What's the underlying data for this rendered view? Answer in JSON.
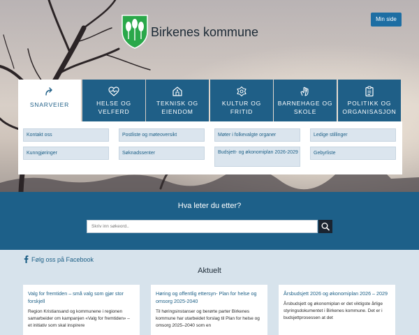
{
  "header": {
    "site_name": "Birkenes kommune",
    "min_side_label": "Min side"
  },
  "tabs": [
    {
      "line1": "SNARVEIER",
      "line2": "",
      "icon": "share-arrow-icon",
      "active": true
    },
    {
      "line1": "HELSE OG",
      "line2": "VELFERD",
      "icon": "heart-pulse-icon",
      "active": false
    },
    {
      "line1": "TEKNISK OG",
      "line2": "EIENDOM",
      "icon": "building-icon",
      "active": false
    },
    {
      "line1": "KULTUR OG",
      "line2": "FRITID",
      "icon": "flower-icon",
      "active": false
    },
    {
      "line1": "BARNEHAGE OG",
      "line2": "SKOLE",
      "icon": "hand-icon",
      "active": false
    },
    {
      "line1": "POLITIKK OG",
      "line2": "ORGANISASJON",
      "icon": "clipboard-icon",
      "active": false
    }
  ],
  "shortcuts": [
    {
      "label": "Kontakt oss"
    },
    {
      "label": "Postliste og møteoversikt"
    },
    {
      "label": "Møter i folkevalgte organer"
    },
    {
      "label": "Ledige stillinger"
    },
    {
      "label": "Kunngjøringer"
    },
    {
      "label": "Søknadssenter"
    },
    {
      "label": "Budsjett- og økonomiplan 2026-2029"
    },
    {
      "label": "Gebyrliste"
    }
  ],
  "search": {
    "title": "Hva leter du etter?",
    "placeholder": "Skriv inn søkeord..",
    "icon": "search-icon"
  },
  "facebook": {
    "label": "Følg oss på Facebook",
    "icon": "facebook-icon"
  },
  "news": {
    "title": "Aktuelt",
    "items": [
      {
        "title": "Valg for fremtiden – små valg som gjør stor forskjell",
        "text": "Region Kristiansand og kommunene i regionen samarbeider om kampanjen «Valg for fremtiden» – et initiativ som skal inspirere"
      },
      {
        "title": "Høring og offentlig ettersyn- Plan for helse og omsorg 2025-2040",
        "text": "Til høringsinstanser og berørte parter Birkenes kommune har utarbeidet forslag til Plan for helse og omsorg 2025–2040 som en"
      },
      {
        "title": "Årsbudsjett 2026 og økonomiplan 2026 – 2029",
        "text": "Årsbudsjett og økonomiplan er det viktigste årlige styringsdokumentet i Birkenes kommune. Det er i budsjettprosessen at det"
      }
    ]
  },
  "colors": {
    "primary": "#1f5f87",
    "band": "#1d6089",
    "page_bg": "#d7e3ec",
    "logo_green": "#2aa84a"
  }
}
